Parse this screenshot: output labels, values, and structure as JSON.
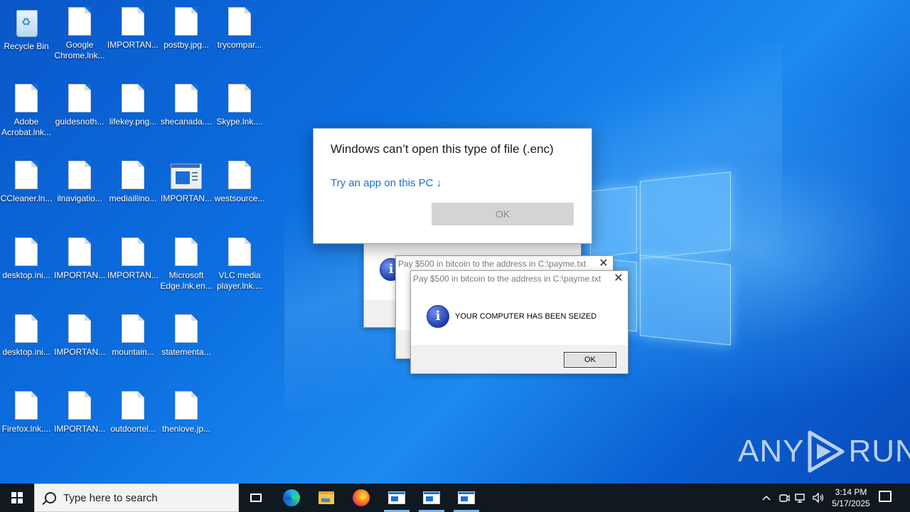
{
  "desktop": {
    "icons": [
      {
        "label": "Recycle Bin"
      },
      {
        "label": "Google Chrome.lnk..."
      },
      {
        "label": "IMPORTAN..."
      },
      {
        "label": "postby.jpg..."
      },
      {
        "label": "trycompar..."
      },
      {
        "label": "Adobe Acrobat.lnk..."
      },
      {
        "label": "guidesnoth..."
      },
      {
        "label": "lifekey.png..."
      },
      {
        "label": "shecanada...."
      },
      {
        "label": "Skype.lnk...."
      },
      {
        "label": "CCleaner.ln..."
      },
      {
        "label": "ilnavigatio..."
      },
      {
        "label": "mediaillino..."
      },
      {
        "label": "IMPORTAN..."
      },
      {
        "label": "westsource..."
      },
      {
        "label": "desktop.ini..."
      },
      {
        "label": "IMPORTAN..."
      },
      {
        "label": "IMPORTAN..."
      },
      {
        "label": "Microsoft Edge.lnk.en..."
      },
      {
        "label": "VLC media player.lnk...."
      },
      {
        "label": "desktop.ini..."
      },
      {
        "label": "IMPORTAN..."
      },
      {
        "label": "mountain..."
      },
      {
        "label": "statementa..."
      },
      {
        "label": "Firefox.lnk...."
      },
      {
        "label": "IMPORTAN..."
      },
      {
        "label": "outdoortel..."
      },
      {
        "label": "thenlove.jp..."
      }
    ]
  },
  "open_with_dialog": {
    "title": "Windows can’t open this type of file (.enc)",
    "try_app": "Try an app on this PC ↓",
    "ok_label": "OK"
  },
  "ransom_dialog_back": {
    "title": "Pay $500 in bitcoin to the address in C:\\payme.txt",
    "close": "✕"
  },
  "ransom_dialog_front": {
    "title": "Pay $500 in bitcoin to the address in C:\\payme.txt",
    "close": "✕",
    "message": "YOUR COMPUTER HAS BEEN SEIZED",
    "ok_label": "OK",
    "icon_glyph": "i"
  },
  "taskbar": {
    "search_placeholder": "Type here to search",
    "time": "3:14 PM",
    "date": "5/17/2025",
    "tray_chevron": "^"
  },
  "watermark": {
    "left": "ANY",
    "right": "RUN"
  },
  "colors": {
    "accent": "#1a6fd0",
    "taskbar": "#101820",
    "desktop": "#0c6fe0"
  }
}
